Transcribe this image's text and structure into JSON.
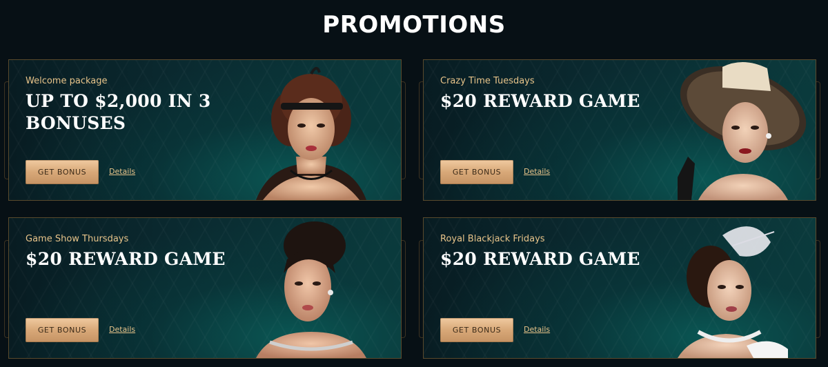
{
  "page": {
    "title": "PROMOTIONS"
  },
  "promotions": [
    {
      "subtitle": "Welcome package",
      "headline": "UP TO $2,000 IN 3 BONUSES",
      "button_label": "GET BONUS",
      "details_label": "Details"
    },
    {
      "subtitle": "Crazy Time Tuesdays",
      "headline": "$20 REWARD GAME",
      "button_label": "GET BONUS",
      "details_label": "Details"
    },
    {
      "subtitle": "Game Show Thursdays",
      "headline": "$20 REWARD GAME",
      "button_label": "GET BONUS",
      "details_label": "Details"
    },
    {
      "subtitle": "Royal Blackjack Fridays",
      "headline": "$20 REWARD GAME",
      "button_label": "GET BONUS",
      "details_label": "Details"
    }
  ],
  "colors": {
    "background": "#071015",
    "accent_gold": "#e8c48a",
    "button_gold": "#d8a878",
    "card_teal": "#0b3a3c"
  }
}
